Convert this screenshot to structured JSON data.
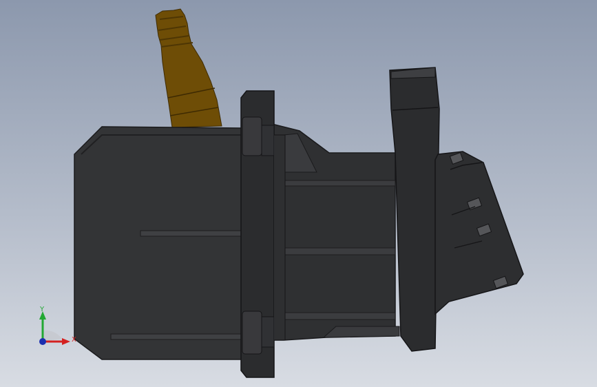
{
  "viewport": {
    "background_top": "#8c98ad",
    "background_bottom": "#d8dce3"
  },
  "model": {
    "body_color": "#333436",
    "edge_color": "#1a1a1c",
    "cable_color": "#6e4d06",
    "cable_dark": "#4e3604"
  },
  "triad": {
    "y_label": "Y",
    "x_label": "X",
    "y_color": "#22a833",
    "x_color": "#d42121",
    "z_color": "#1c2fb0"
  }
}
